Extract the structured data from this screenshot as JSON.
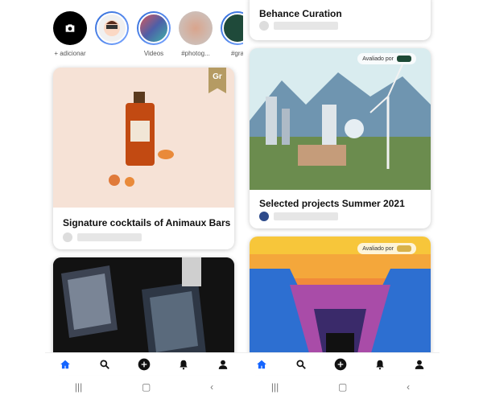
{
  "left_screen": {
    "stories": [
      {
        "label": "+ adicionar",
        "icon": "camera-icon"
      },
      {
        "label": ""
      },
      {
        "label": "Videos"
      },
      {
        "label": "#photog..."
      },
      {
        "label": "#gra"
      }
    ],
    "card1": {
      "title": "Signature cocktails of Animaux Bars",
      "badge": "Gr"
    },
    "card2": {
      "badge": ""
    }
  },
  "right_screen": {
    "card_top": {
      "title": "Behance Curation"
    },
    "card1": {
      "title": "Selected projects Summer 2021",
      "badge_text": "Avaliado por"
    },
    "card2": {
      "badge_text": "Avaliado por"
    }
  },
  "nav": {
    "items": [
      "home-icon",
      "search-icon",
      "add-icon",
      "bell-icon",
      "profile-icon"
    ],
    "active_color": "#1565ff"
  }
}
